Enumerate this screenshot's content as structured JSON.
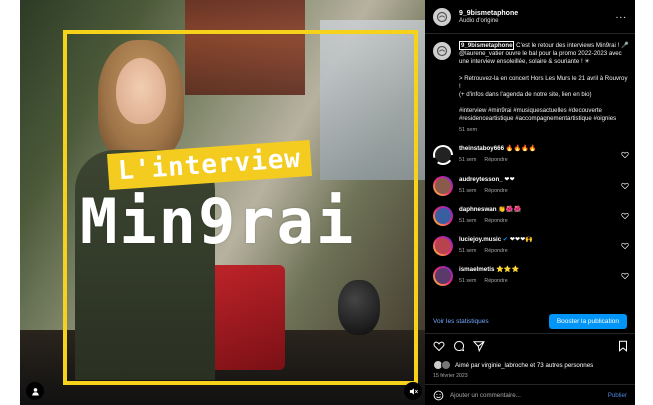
{
  "media": {
    "badge_text": "L'interview",
    "title_text": "Min9rai"
  },
  "header": {
    "username": "9_9bismetaphone",
    "audio": "Audio d'origine",
    "more": "..."
  },
  "caption": {
    "username": "9_9bismetaphone",
    "line1": " C'est le retour des interviews Min9rai ! 🎤 @laurene_vatier ouvre le bal pour la promo 2022-2023 avec une interview ensoleillée, solaire & souriante ! ☀",
    "line2": "> Retrouvez-la en concert Hors Les Murs le 21 avril à Rouvroy !",
    "line3": "(+ d'infos dans l'agenda de notre site, lien en bio)",
    "hashtags": "#interview #min9rai #musiquesactuelles #decouverte #residenceartistique #accompagnementartistique #oignies",
    "time": "51 sem"
  },
  "comments": [
    {
      "user": "theinstaboy666",
      "text": "🔥🔥🔥🔥",
      "time": "51 sem",
      "reply": "Répondre",
      "avatar_color": "#222222"
    },
    {
      "user": "audreytesson_",
      "text": "❤❤",
      "time": "51 sem",
      "reply": "Répondre",
      "avatar_color": "#8a5a4b"
    },
    {
      "user": "daphneswan",
      "text": "👏🌺🌺",
      "time": "51 sem",
      "reply": "Répondre",
      "avatar_color": "#3a5fa0"
    },
    {
      "user": "luciejoy.music",
      "verified": "✔",
      "text": "❤❤❤🙌",
      "time": "51 sem",
      "reply": "Répondre",
      "avatar_color": "#b8434f"
    },
    {
      "user": "ismaelmetis",
      "text": "⭐⭐⭐",
      "time": "51 sem",
      "reply": "Répondre",
      "avatar_color": "#5a3a6a"
    }
  ],
  "stats": {
    "link": "Voir les statistiques",
    "boost": "Booster la publication"
  },
  "likes": {
    "text": "Aimé par virginie_labroche et 73 autres personnes",
    "date": "15 février 2023"
  },
  "comment_box": {
    "placeholder": "Ajouter un commentaire...",
    "publish": "Publier"
  },
  "colors": {
    "accent_yellow": "#f4cc1f",
    "link_blue": "#70a7ff",
    "button_blue": "#0095f6"
  }
}
